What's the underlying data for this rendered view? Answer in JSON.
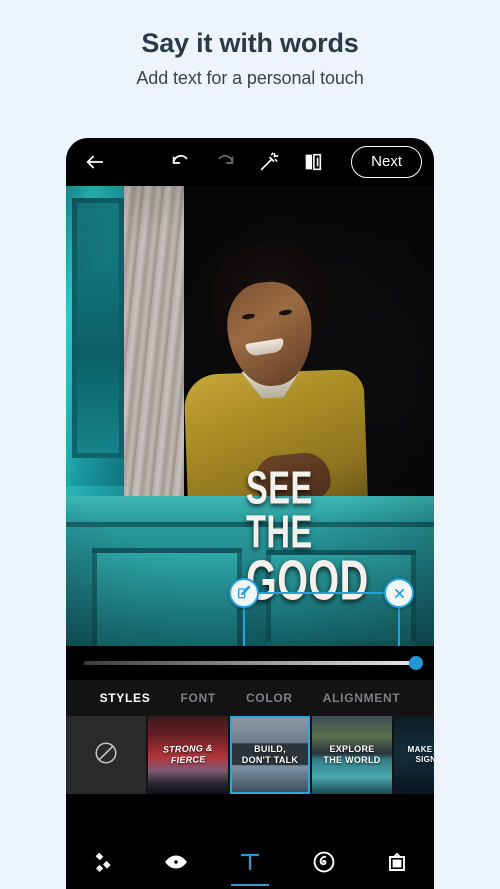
{
  "promo": {
    "title": "Say it with words",
    "subtitle": "Add text for a personal touch"
  },
  "colors": {
    "page_background": "#edf4fc",
    "accent_blue": "#22a3dd",
    "nav_active": "#2a9ad6",
    "app_background": "#000000"
  },
  "toolbar": {
    "back_icon": "back-arrow-icon",
    "undo_icon": "undo-icon",
    "redo_icon": "redo-icon",
    "magic_icon": "magic-wand-icon",
    "compare_icon": "before-after-compare-icon",
    "next_label": "Next"
  },
  "canvas": {
    "photo_alt": "Smiling boy leaning out of a teal window",
    "text_overlay": {
      "line1": "SEE THE",
      "line2": "GOOD"
    },
    "handles": {
      "edit": "edit-pencil-icon",
      "close": "close-x-icon",
      "rotate": "rotate-icon",
      "resize": "resize-diagonal-icon"
    }
  },
  "slider": {
    "name": "opacity-slider",
    "value": 100,
    "min": 0,
    "max": 100
  },
  "tabs": [
    {
      "label": "STYLES",
      "active": true
    },
    {
      "label": "FONT",
      "active": false
    },
    {
      "label": "COLOR",
      "active": false
    },
    {
      "label": "ALIGNMENT",
      "active": false
    }
  ],
  "styles": [
    {
      "id": "none",
      "label": "",
      "icon": "no-style-icon",
      "selected": false
    },
    {
      "id": "strong-fierce",
      "label": "STRONG &\nFIERCE",
      "selected": false
    },
    {
      "id": "build-dont-talk",
      "label": "BUILD,\nDON'T TALK",
      "selected": true
    },
    {
      "id": "explore-the-world",
      "label": "EXPLORE\nTHE WORLD",
      "selected": false
    },
    {
      "id": "make-it-simple",
      "label": "MAKE IT SIM\nSIGNIFIC",
      "selected": false
    }
  ],
  "bottom_nav": [
    {
      "id": "heal",
      "icon": "heal-patch-icon",
      "active": false
    },
    {
      "id": "looks",
      "icon": "eye-looks-icon",
      "active": false
    },
    {
      "id": "text",
      "icon": "text-t-icon",
      "active": true
    },
    {
      "id": "retouch",
      "icon": "retouch-swirl-icon",
      "active": false
    },
    {
      "id": "frames",
      "icon": "frame-border-icon",
      "active": false
    }
  ]
}
